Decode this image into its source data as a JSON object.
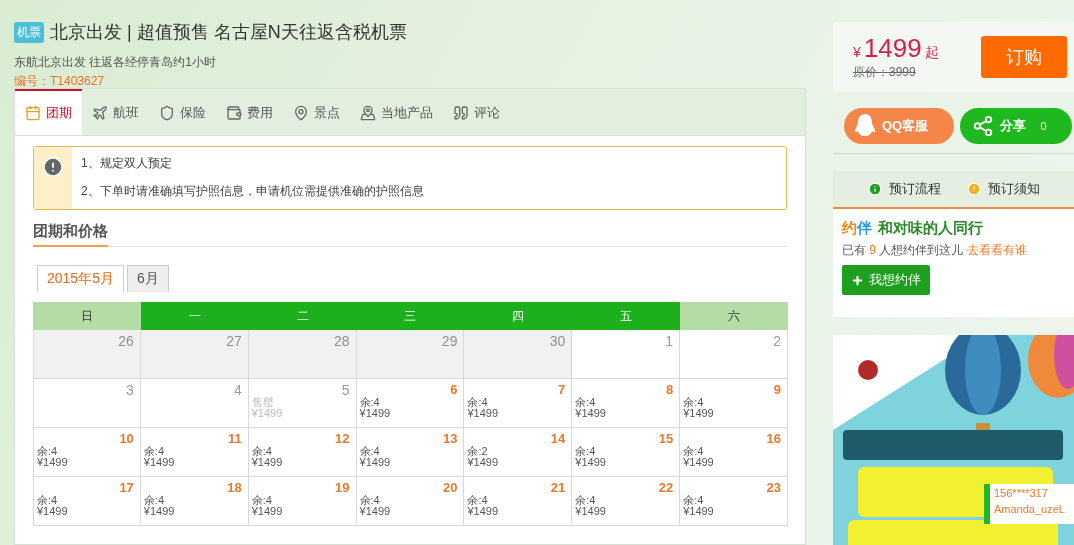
{
  "header": {
    "badge": "机票",
    "title": "北京出发 | 超值预售 名古屋N天往返含税机票",
    "subtitle": "东航北京出发 往返各经停青岛约1小时",
    "code": "编号：T1403627"
  },
  "tabs": [
    {
      "label": "团期",
      "selected": true
    },
    {
      "label": "航班",
      "selected": false
    },
    {
      "label": "保险",
      "selected": false
    },
    {
      "label": "费用",
      "selected": false
    },
    {
      "label": "景点",
      "selected": false
    },
    {
      "label": "当地产品",
      "selected": false
    },
    {
      "label": "评论",
      "selected": false
    }
  ],
  "notice": [
    "1、规定双人预定",
    "2、下单时请准确填写护照信息，申请机位需提供准确的护照信息"
  ],
  "section_title": "团期和价格",
  "months": [
    {
      "label": "2015年5月",
      "selected": true
    },
    {
      "label": "6月",
      "selected": false
    }
  ],
  "weekdays": [
    {
      "label": "日",
      "kind": "weekend"
    },
    {
      "label": "一",
      "kind": "weekday"
    },
    {
      "label": "二",
      "kind": "weekday"
    },
    {
      "label": "三",
      "kind": "weekday"
    },
    {
      "label": "四",
      "kind": "weekday"
    },
    {
      "label": "五",
      "kind": "weekday"
    },
    {
      "label": "六",
      "kind": "weekend"
    }
  ],
  "weeks": [
    [
      {
        "day": "26",
        "kind": "past"
      },
      {
        "day": "27",
        "kind": "past"
      },
      {
        "day": "28",
        "kind": "past"
      },
      {
        "day": "29",
        "kind": "past"
      },
      {
        "day": "30",
        "kind": "past"
      },
      {
        "day": "1",
        "kind": "plain"
      },
      {
        "day": "2",
        "kind": "plain"
      }
    ],
    [
      {
        "day": "3",
        "kind": "plain"
      },
      {
        "day": "4",
        "kind": "plain"
      },
      {
        "day": "5",
        "kind": "soldout",
        "status": "售罄",
        "price": "¥1499"
      },
      {
        "day": "6",
        "kind": "available",
        "status": "余:4",
        "price": "¥1499"
      },
      {
        "day": "7",
        "kind": "available",
        "status": "余:4",
        "price": "¥1499"
      },
      {
        "day": "8",
        "kind": "available",
        "status": "余:4",
        "price": "¥1499"
      },
      {
        "day": "9",
        "kind": "available",
        "status": "余:4",
        "price": "¥1499"
      }
    ],
    [
      {
        "day": "10",
        "kind": "available",
        "status": "余:4",
        "price": "¥1499"
      },
      {
        "day": "11",
        "kind": "available",
        "status": "余:4",
        "price": "¥1499"
      },
      {
        "day": "12",
        "kind": "available",
        "status": "余:4",
        "price": "¥1499"
      },
      {
        "day": "13",
        "kind": "available",
        "status": "余:4",
        "price": "¥1499"
      },
      {
        "day": "14",
        "kind": "available",
        "status": "余:2",
        "price": "¥1499"
      },
      {
        "day": "15",
        "kind": "available",
        "status": "余:4",
        "price": "¥1499"
      },
      {
        "day": "16",
        "kind": "available",
        "status": "余:4",
        "price": "¥1499"
      }
    ],
    [
      {
        "day": "17",
        "kind": "available",
        "status": "余:4",
        "price": "¥1499"
      },
      {
        "day": "18",
        "kind": "available",
        "status": "余:4",
        "price": "¥1499"
      },
      {
        "day": "19",
        "kind": "available",
        "status": "余:4",
        "price": "¥1499"
      },
      {
        "day": "20",
        "kind": "available",
        "status": "余:4",
        "price": "¥1499"
      },
      {
        "day": "21",
        "kind": "available",
        "status": "余:4",
        "price": "¥1499"
      },
      {
        "day": "22",
        "kind": "available",
        "status": "余:4",
        "price": "¥1499"
      },
      {
        "day": "23",
        "kind": "available",
        "status": "余:4",
        "price": "¥1499"
      }
    ]
  ],
  "price": {
    "currency": "¥",
    "amount": "1499",
    "suffix": "起",
    "original": "原价：3999",
    "buy": "订购"
  },
  "service": {
    "qq": "QQ客服",
    "share": "分享",
    "share_count": "0"
  },
  "booking_tabs": [
    {
      "label": "预订流程",
      "kind": "info"
    },
    {
      "label": "预订须知",
      "kind": "warning"
    }
  ],
  "companion": {
    "logo_a": "约",
    "logo_b": "伴",
    "title": "和对味的人同行",
    "text_before": "已有",
    "count": "9",
    "text_after": "人想约伴到这儿",
    "link": "去看看有谁",
    "button": "我想约伴"
  },
  "toast": {
    "line1": "156****317",
    "line2": "Amanda_uzeL"
  }
}
